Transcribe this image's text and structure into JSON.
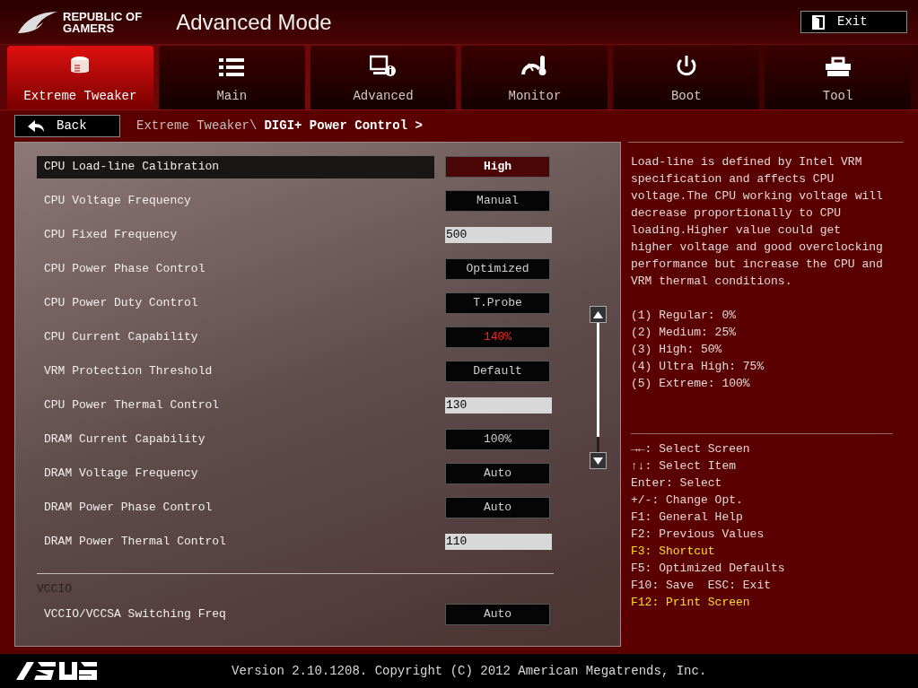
{
  "header": {
    "brand": [
      "REPUBLIC OF",
      "GAMERS"
    ],
    "title": "Advanced Mode",
    "exit": "Exit"
  },
  "tabs": [
    {
      "label": "Extreme Tweaker",
      "selected": true
    },
    {
      "label": "Main",
      "selected": false
    },
    {
      "label": "Advanced",
      "selected": false
    },
    {
      "label": "Monitor",
      "selected": false
    },
    {
      "label": "Boot",
      "selected": false
    },
    {
      "label": "Tool",
      "selected": false
    }
  ],
  "breadcrumb": {
    "back": "Back",
    "path": "Extreme Tweaker\\",
    "current": "DIGI+ Power Control >"
  },
  "settings": [
    {
      "kind": "option",
      "label": "CPU Load-line Calibration",
      "value": "High",
      "selected": true,
      "alert": false
    },
    {
      "kind": "option",
      "label": "CPU Voltage Frequency",
      "value": "Manual",
      "selected": false,
      "alert": false
    },
    {
      "kind": "number",
      "label": "CPU Fixed Frequency",
      "value": "500",
      "selected": false
    },
    {
      "kind": "option",
      "label": "CPU Power Phase Control",
      "value": "Optimized",
      "selected": false,
      "alert": false
    },
    {
      "kind": "option",
      "label": "CPU Power Duty Control",
      "value": "T.Probe",
      "selected": false,
      "alert": false
    },
    {
      "kind": "option",
      "label": "CPU Current Capability",
      "value": "140%",
      "selected": false,
      "alert": true
    },
    {
      "kind": "option",
      "label": "VRM Protection Threshold",
      "value": "Default",
      "selected": false,
      "alert": false
    },
    {
      "kind": "number",
      "label": "CPU Power Thermal Control",
      "value": "130",
      "selected": false
    },
    {
      "kind": "option",
      "label": "DRAM Current Capability",
      "value": "100%",
      "selected": false,
      "alert": false
    },
    {
      "kind": "option",
      "label": "DRAM Voltage Frequency",
      "value": "Auto",
      "selected": false,
      "alert": false
    },
    {
      "kind": "option",
      "label": "DRAM Power Phase Control",
      "value": "Auto",
      "selected": false,
      "alert": false
    },
    {
      "kind": "number",
      "label": "DRAM Power Thermal Control",
      "value": "110",
      "selected": false
    },
    {
      "kind": "section",
      "label": "VCCIO"
    },
    {
      "kind": "option",
      "label": "VCCIO/VCCSA Switching Freq",
      "value": "Auto",
      "selected": false,
      "alert": false
    }
  ],
  "help": {
    "description": "Load-line is defined by Intel VRM specification and affects CPU voltage.The CPU working voltage will decrease proportionally to CPU loading.Higher value could get higher voltage and good overclocking performance but increase the CPU and VRM thermal conditions.",
    "levels": [
      "(1) Regular: 0%",
      "(2) Medium: 25%",
      "(3) High: 50%",
      "(4) Ultra High: 75%",
      "(5) Extreme: 100%"
    ],
    "keys": [
      {
        "text": "→←: Select Screen",
        "highlighted": false
      },
      {
        "text": "↑↓: Select Item",
        "highlighted": false
      },
      {
        "text": "Enter: Select",
        "highlighted": false
      },
      {
        "text": "+/-: Change Opt.",
        "highlighted": false
      },
      {
        "text": "F1: General Help",
        "highlighted": false
      },
      {
        "text": "F2: Previous Values",
        "highlighted": false
      },
      {
        "text": "F3: Shortcut",
        "highlighted": true
      },
      {
        "text": "F5: Optimized Defaults",
        "highlighted": false
      },
      {
        "text": "F10: Save  ESC: Exit",
        "highlighted": false
      },
      {
        "text": "F12: Print Screen",
        "highlighted": true
      }
    ]
  },
  "footer": {
    "version": "Version 2.10.1208. Copyright (C) 2012 American Megatrends, Inc."
  }
}
